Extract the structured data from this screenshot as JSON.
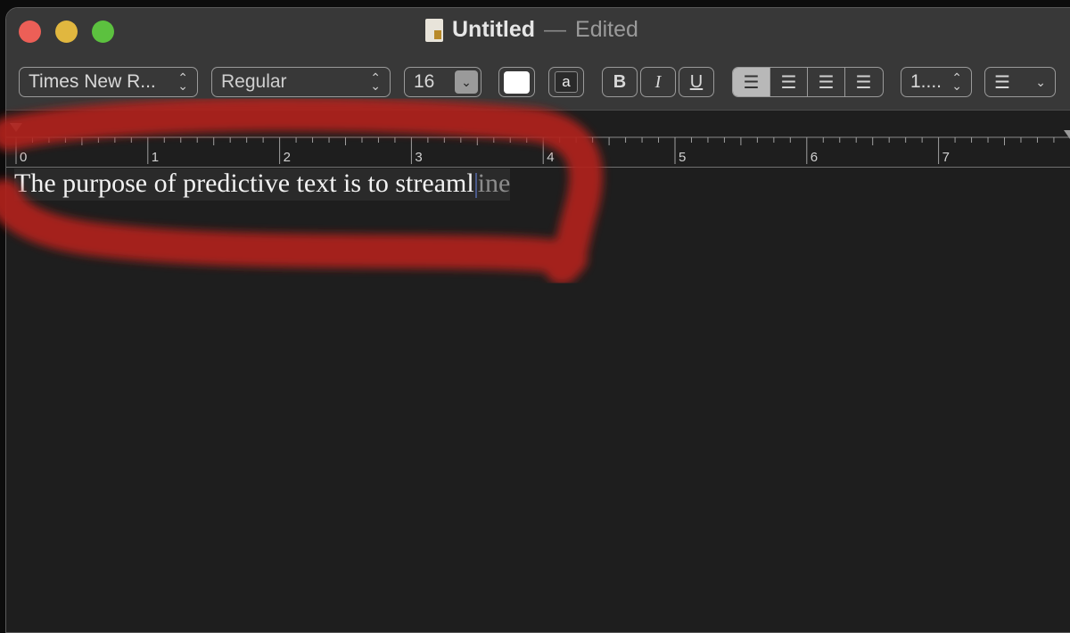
{
  "window": {
    "title": "Untitled",
    "separator": "—",
    "status": "Edited",
    "traffic_lights": {
      "close": "#ec5f57",
      "minimize": "#e1b73f",
      "zoom": "#5cc13f"
    }
  },
  "toolbar": {
    "font_family": "Times New R...",
    "font_style": "Regular",
    "font_size": "16",
    "text_color": "#ffffff",
    "background_color_label": "a",
    "bold_label": "B",
    "italic_label": "I",
    "underline_label": "U",
    "alignment": {
      "options": [
        "align-left",
        "align-center",
        "align-right",
        "justify"
      ],
      "selected": "align-left"
    },
    "line_spacing": "1....",
    "list_icon": "list-bullets-icon"
  },
  "ruler": {
    "labels": [
      "0",
      "1",
      "2",
      "3",
      "4",
      "5",
      "6",
      "7"
    ]
  },
  "document": {
    "typed_text": "The purpose of predictive text is to streaml",
    "predicted_text": "ine"
  },
  "annotation": {
    "color": "#b0231a"
  }
}
